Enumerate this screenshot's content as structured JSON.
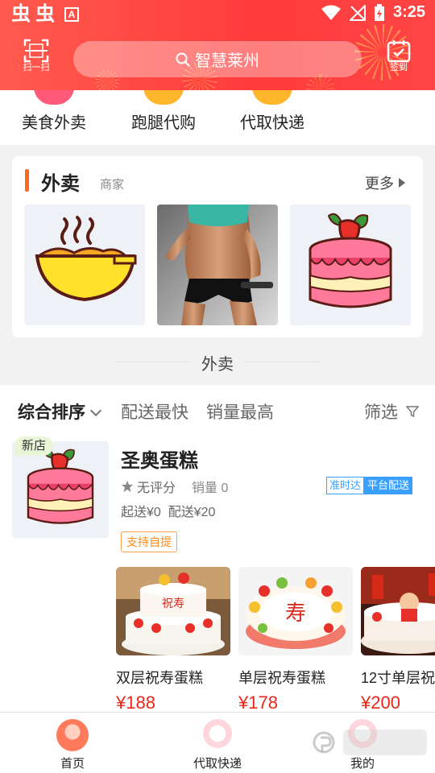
{
  "status_bar": {
    "time": "3:25"
  },
  "header": {
    "scan_label": "扫一扫",
    "search_placeholder": "智慧莱州",
    "checkin_label": "签到"
  },
  "categories": [
    {
      "label": "美食外卖",
      "color": "#ff5a7a"
    },
    {
      "label": "跑腿代购",
      "color": "#ffb62a"
    },
    {
      "label": "代取快递",
      "color": "#ffb62a"
    }
  ],
  "takeaway_card": {
    "title": "外卖",
    "subtitle": "商家",
    "more_label": "更多",
    "tiles": [
      "bowl",
      "fitness-photo",
      "cake"
    ]
  },
  "section_title": "外卖",
  "sort_bar": {
    "options": [
      "综合排序",
      "配送最快",
      "销量最高"
    ],
    "filter_label": "筛选"
  },
  "shop": {
    "badge": "新店",
    "name": "圣奥蛋糕",
    "rating": "无评分",
    "sales": "销量 0",
    "tag_ontime": "准时达",
    "tag_delivery": "平台配送",
    "min_order": "起送¥0",
    "delivery_fee": "配送¥20",
    "pickup": "支持自提"
  },
  "products": [
    {
      "name": "双层祝寿蛋糕",
      "price": "¥188"
    },
    {
      "name": "单层祝寿蛋糕",
      "price": "¥178"
    },
    {
      "name": "12寸单层祝",
      "price": "¥200"
    }
  ],
  "bottom_nav": [
    {
      "label": "首页"
    },
    {
      "label": "代取快递"
    },
    {
      "label": "我的"
    }
  ],
  "colors": {
    "header": "#ff3b3b",
    "price": "#e8271a",
    "accent": "#ff6a1a",
    "tag_blue": "#3aa0ff"
  }
}
